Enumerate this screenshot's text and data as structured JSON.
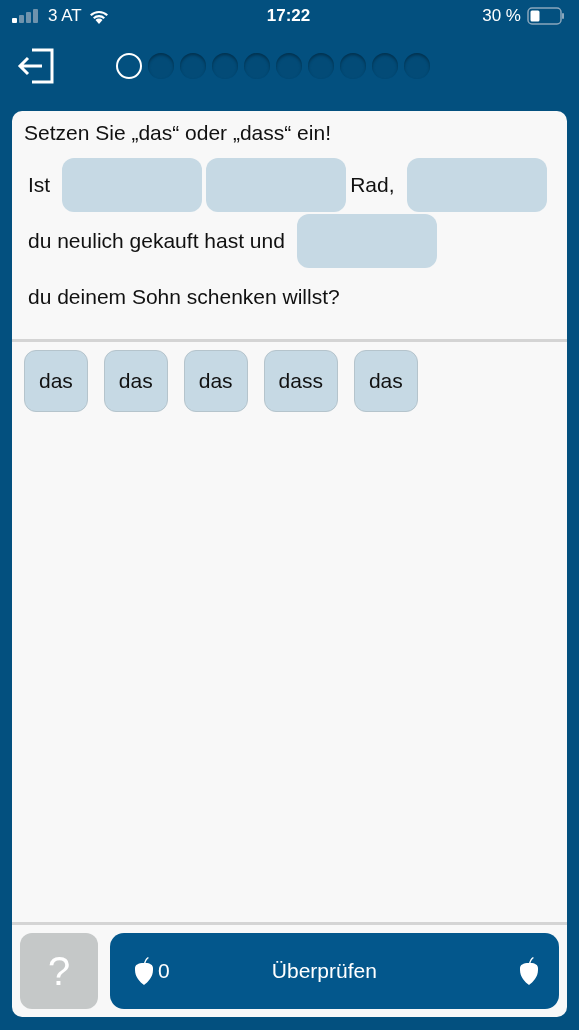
{
  "status_bar": {
    "carrier": "3 AT",
    "time": "17:22",
    "battery": "30 %"
  },
  "progress": [
    {
      "current": true
    },
    {
      "current": false
    },
    {
      "current": false
    },
    {
      "current": false
    },
    {
      "current": false
    },
    {
      "current": false
    },
    {
      "current": false
    },
    {
      "current": false
    },
    {
      "current": false
    },
    {
      "current": false
    }
  ],
  "instruction": "Setzen Sie „das“ oder „dass“ ein!",
  "sentence_lines": [
    [
      {
        "kind": "text",
        "text": "Ist"
      },
      {
        "kind": "blank"
      },
      {
        "kind": "blank"
      },
      {
        "kind": "text",
        "text": "Rad,"
      },
      {
        "kind": "blank"
      }
    ],
    [
      {
        "kind": "text",
        "text": "du neulich gekauft hast und"
      },
      {
        "kind": "blank"
      }
    ],
    [
      {
        "kind": "text",
        "text": "du deinem Sohn schenken willst?"
      }
    ]
  ],
  "choices": [
    "das",
    "das",
    "das",
    "dass",
    "das"
  ],
  "help_button": {
    "label": "?",
    "disabled": true
  },
  "check_button": {
    "label": "Überprüfen",
    "count": "0"
  }
}
